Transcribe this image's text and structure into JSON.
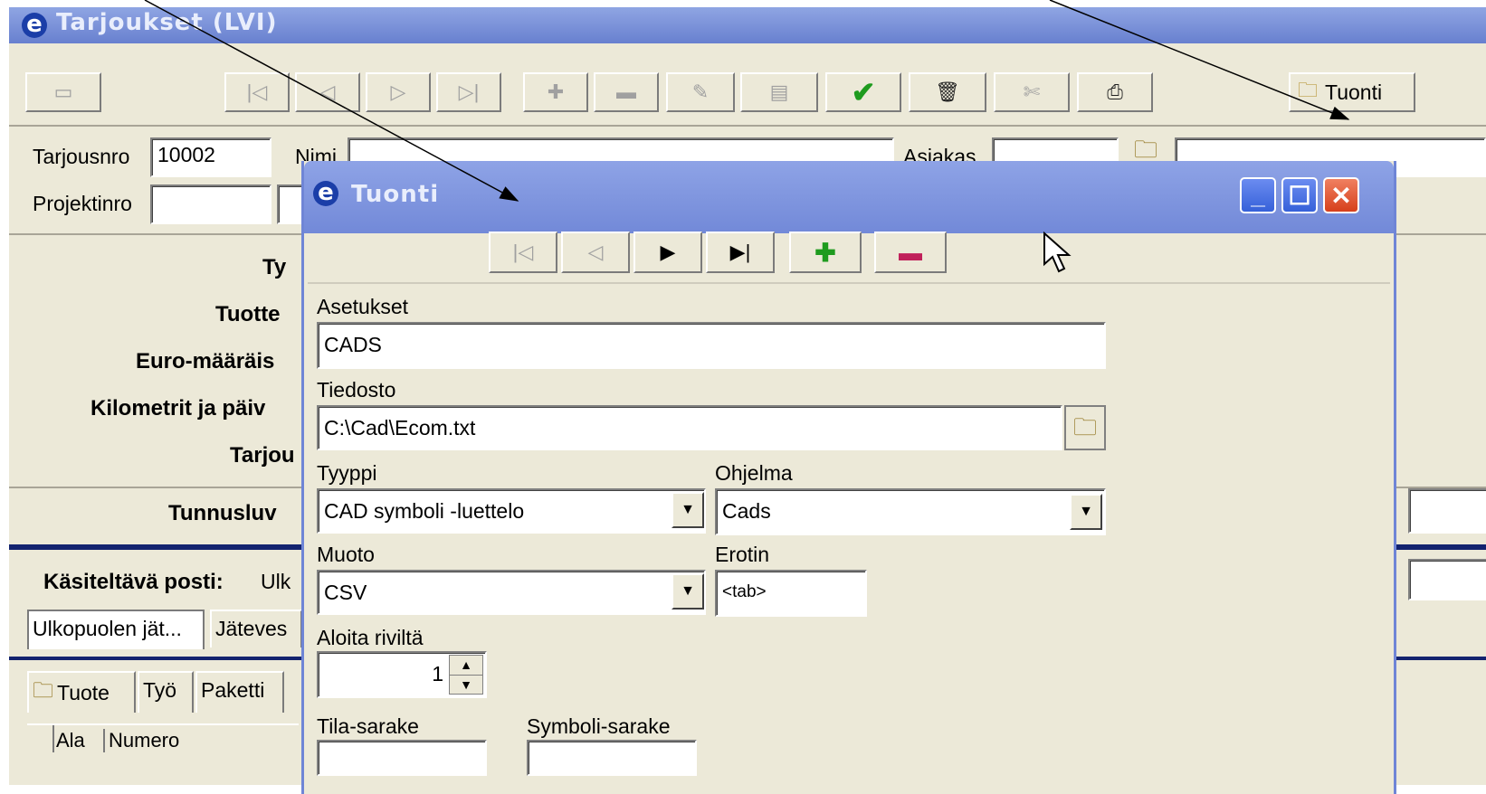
{
  "main": {
    "title": "Tarjoukset (LVI)",
    "import_button": "Tuonti",
    "fields": {
      "tarjousnro_label": "Tarjousnro",
      "tarjousnro_value": "10002",
      "nimi_label": "Nimi",
      "asiakas_label": "Asiakas",
      "projektinro_label": "Projektinro"
    },
    "section_labels": [
      "Ty",
      "Tuotte",
      "Euro-määräis",
      "Kilometrit ja päiv",
      "Tarjou",
      "Tunnusluv"
    ],
    "mail_label": "Käsiteltävä posti:",
    "mail_value": "Ulk",
    "tabs": [
      "Ulkopuolen jät...",
      "Jäteves"
    ],
    "item_tabs": [
      "Tuote",
      "Työ",
      "Paketti"
    ],
    "table_headers": [
      "Ala",
      "Numero"
    ]
  },
  "dialog": {
    "title": "Tuonti",
    "asetukset_label": "Asetukset",
    "asetukset_value": "CADS",
    "tiedosto_label": "Tiedosto",
    "tiedosto_value": "C:\\Cad\\Ecom.txt",
    "tyyppi_label": "Tyyppi",
    "tyyppi_value": "CAD symboli -luettelo",
    "ohjelma_label": "Ohjelma",
    "ohjelma_value": "Cads",
    "muoto_label": "Muoto",
    "muoto_value": "CSV",
    "erotin_label": "Erotin",
    "erotin_value": "<tab>",
    "aloita_label": "Aloita riviltä",
    "aloita_value": "1",
    "tila_label": "Tila-sarake",
    "symboli_label": "Symboli-sarake"
  }
}
